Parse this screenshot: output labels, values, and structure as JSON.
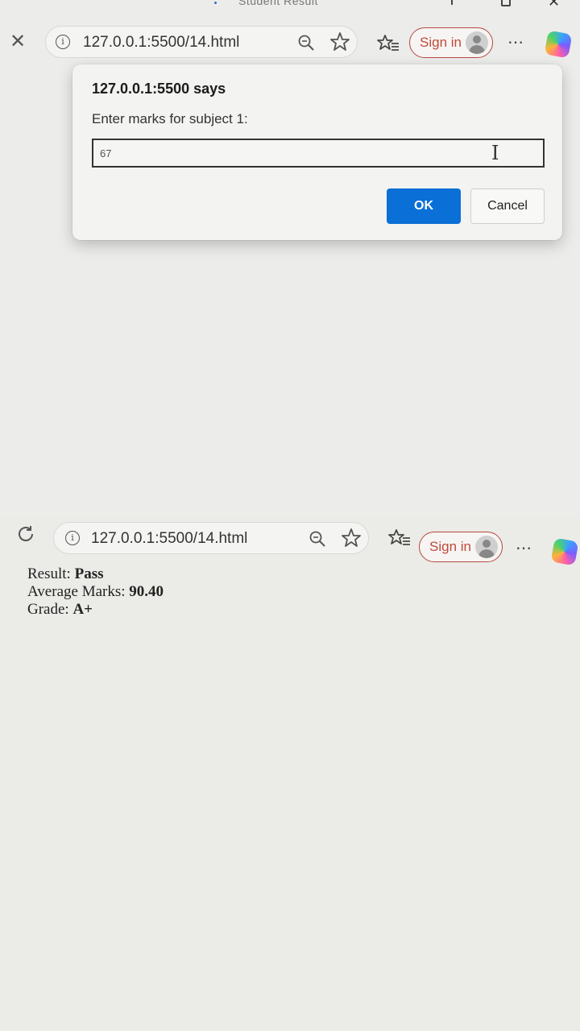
{
  "shot1": {
    "tab_title": "Student Result",
    "url": "127.0.0.1:5500/14.html",
    "sign_in": "Sign in",
    "more": "⋯",
    "dialog": {
      "title": "127.0.0.1:5500 says",
      "message": "Enter marks for subject 1:",
      "input_value": "67",
      "ok_label": "OK",
      "cancel_label": "Cancel"
    }
  },
  "shot2": {
    "url": "127.0.0.1:5500/14.html",
    "sign_in": "Sign in",
    "more": "⋯",
    "result": {
      "result_label": "Result:",
      "result_value": "Pass",
      "avg_label": "Average Marks:",
      "avg_value": "90.40",
      "grade_label": "Grade:",
      "grade_value": "A+"
    }
  },
  "colors": {
    "accent": "#0a6fd6",
    "signin_border": "#b54a3f"
  }
}
